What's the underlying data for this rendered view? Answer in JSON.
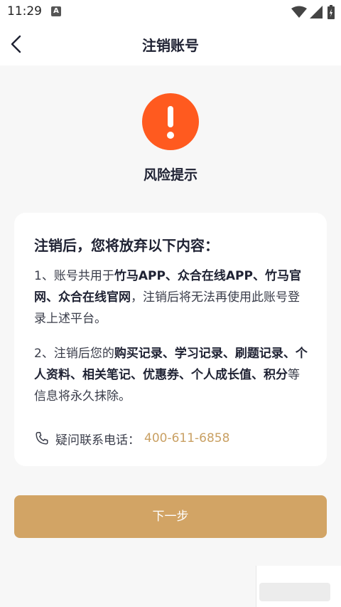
{
  "status": {
    "time": "11:29",
    "notification_icon": "A"
  },
  "header": {
    "title": "注销账号",
    "back_icon": "back-arrow-icon"
  },
  "warning": {
    "icon": "exclamation-icon",
    "color": "#ff5a1f",
    "title": "风险提示"
  },
  "card": {
    "title": "注销后，您将放弃以下内容：",
    "p1": {
      "a": "1、账号共用于",
      "b": "竹马APP、众合在线APP、竹马官网、众合在线官网",
      "c": "，注销后将无法再使用此账号登录上述平台。"
    },
    "p2": {
      "a": "2、注销后您的",
      "b": "购买记录、学习记录、刷题记录、个人资料、相关笔记、优惠券、个人成长值、积分",
      "c": "等信息将永久抹除。"
    },
    "phone": {
      "label": "疑问联系电话：",
      "number": "400-611-6858",
      "icon": "phone-icon"
    }
  },
  "next_button": {
    "label": "下一步",
    "color": "#d2a465"
  }
}
